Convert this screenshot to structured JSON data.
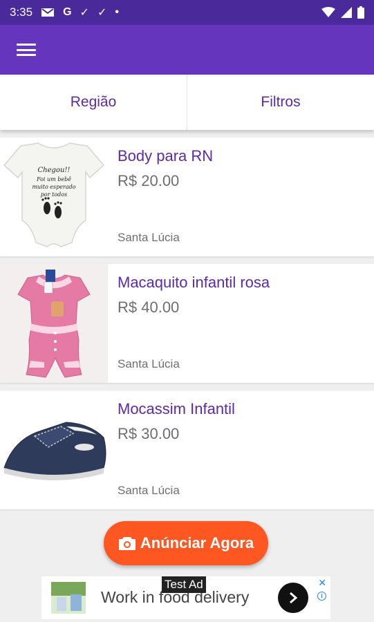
{
  "status_bar": {
    "time": "3:35",
    "icons": [
      "mail-icon",
      "google-icon",
      "check-icon",
      "check-icon",
      "dot-icon"
    ],
    "right_icons": [
      "wifi-icon",
      "signal-icon",
      "battery-icon"
    ],
    "google_glyph": "G",
    "check_glyph": "✓",
    "dot_glyph": "•"
  },
  "app_bar": {
    "menu_icon": "menu-icon",
    "color": "#6535be"
  },
  "tabs": [
    {
      "label": "Região"
    },
    {
      "label": "Filtros"
    }
  ],
  "listings": [
    {
      "title": "Body para RN",
      "price": "R$ 20.00",
      "location": "Santa Lúcia",
      "image": "baby-bodysuit-image",
      "onesie_text": [
        "Chegou!!",
        "Foi um bebê",
        "muito esperado",
        "por todos"
      ]
    },
    {
      "title": "Macaquito infantil rosa",
      "price": "R$ 40.00",
      "location": "Santa Lúcia",
      "image": "pink-romper-image"
    },
    {
      "title": "Mocassim Infantil",
      "price": "R$ 30.00",
      "location": "Santa Lúcia",
      "image": "baby-moccasin-image"
    }
  ],
  "cta": {
    "label": "Anúnciar Agora",
    "icon": "camera-icon",
    "color": "#ff5722"
  },
  "ad": {
    "badge": "Test Ad",
    "text": "Work in food delivery",
    "close_glyph": "✕",
    "info_glyph": "i"
  }
}
